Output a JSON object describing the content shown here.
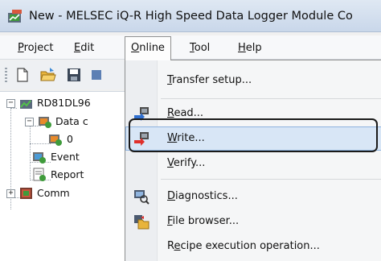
{
  "window": {
    "title": "New - MELSEC iQ-R High Speed Data Logger Module Co"
  },
  "menubar": {
    "items": [
      {
        "name": "menu-project",
        "pre": "",
        "acc": "P",
        "post": "roject"
      },
      {
        "name": "menu-edit",
        "pre": "",
        "acc": "E",
        "post": "dit"
      },
      {
        "name": "menu-online",
        "pre": "",
        "acc": "O",
        "post": "nline"
      },
      {
        "name": "menu-tool",
        "pre": "",
        "acc": "T",
        "post": "ool"
      },
      {
        "name": "menu-help",
        "pre": "",
        "acc": "H",
        "post": "elp"
      }
    ]
  },
  "tree": {
    "nodes": [
      {
        "label": "RD81DL96"
      },
      {
        "label": "Data c"
      },
      {
        "label": "0"
      },
      {
        "label": "Event"
      },
      {
        "label": "Report"
      },
      {
        "label": "Comm"
      }
    ]
  },
  "online_menu": {
    "items": [
      {
        "pre": "",
        "acc": "T",
        "post": "ransfer setup...",
        "icon": ""
      },
      {
        "pre": "",
        "acc": "R",
        "post": "ead...",
        "icon": "read-from-module-icon"
      },
      {
        "pre": "",
        "acc": "W",
        "post": "rite...",
        "icon": "write-to-module-icon"
      },
      {
        "pre": "",
        "acc": "V",
        "post": "erify...",
        "icon": ""
      },
      {
        "pre": "",
        "acc": "D",
        "post": "iagnostics...",
        "icon": "diagnostics-icon"
      },
      {
        "pre": "",
        "acc": "F",
        "post": "ile browser...",
        "icon": "file-browser-icon"
      },
      {
        "pre": "R",
        "acc": "e",
        "post": "cipe execution operation...",
        "icon": ""
      }
    ],
    "highlighted": "Write..."
  },
  "colors": {
    "highlight_bg": "#d8e6f6",
    "highlight_border": "#8fb4df",
    "callout_border": "#1a1a1a"
  }
}
